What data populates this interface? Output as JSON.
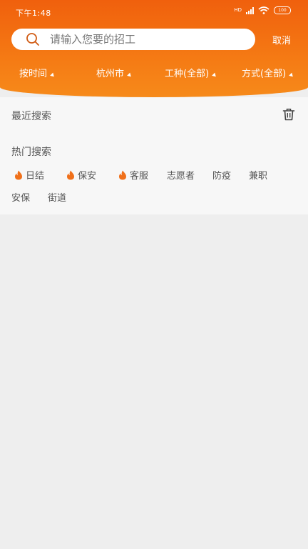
{
  "status_bar": {
    "time": "下午1:48",
    "network": "HD",
    "battery": "100"
  },
  "search": {
    "placeholder": "请输入您要的招工",
    "value": "",
    "cancel_label": "取消"
  },
  "filters": [
    {
      "label": "按时间"
    },
    {
      "label": "杭州市"
    },
    {
      "label": "工种(全部)"
    },
    {
      "label": "方式(全部)"
    }
  ],
  "recent": {
    "title": "最近搜索"
  },
  "hot": {
    "title": "热门搜索",
    "tags": [
      {
        "label": "日结",
        "hot": true
      },
      {
        "label": "保安",
        "hot": true
      },
      {
        "label": "客服",
        "hot": true
      },
      {
        "label": "志愿者",
        "hot": false
      },
      {
        "label": "防疫",
        "hot": false
      },
      {
        "label": "兼职",
        "hot": false
      },
      {
        "label": "安保",
        "hot": false
      },
      {
        "label": "街道",
        "hot": false
      }
    ]
  },
  "colors": {
    "brand": "#f26a10",
    "fire": "#f0701a"
  }
}
